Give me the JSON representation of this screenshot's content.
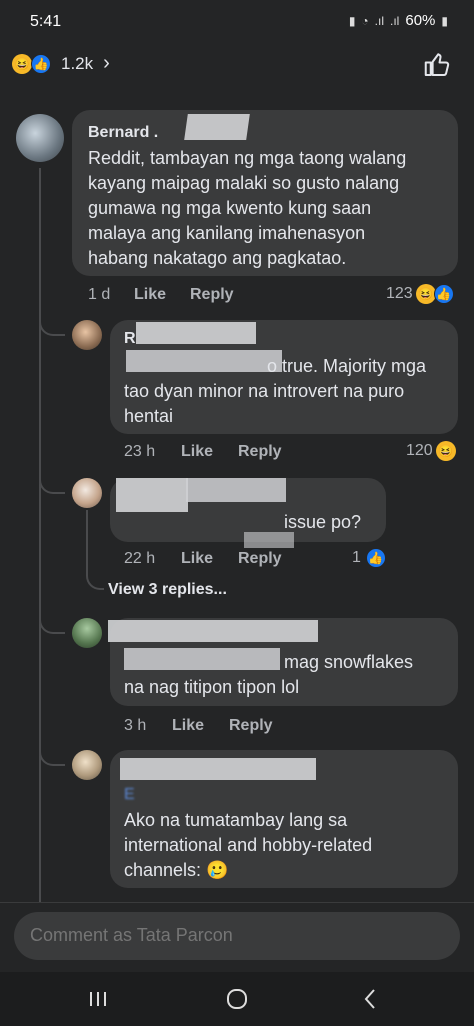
{
  "status": {
    "time": "5:41",
    "battery": "60%"
  },
  "header": {
    "reaction_count": "1.2k"
  },
  "comments": [
    {
      "author": "Bernard .",
      "text_lines": [
        "Reddit, tambayan ng mga taong walang",
        "kayang maipag malaki so gusto nalang",
        "gumawa ng mga kwento kung saan",
        "malaya ang kanilang imahenasyon",
        "habang nakatago ang pagkatao."
      ],
      "time": "1 d",
      "like": "Like",
      "reply": "Reply",
      "reactions": "123"
    },
    {
      "author": "R",
      "text_lines": [
        "o true. Majority mga",
        "tao dyan minor na introvert na puro",
        "hentai"
      ],
      "time": "23 h",
      "like": "Like",
      "reply": "Reply",
      "reactions": "120"
    },
    {
      "text_lines": [
        "issue po?"
      ],
      "time": "22 h",
      "like": "Like",
      "reply": "Reply",
      "reactions": "1"
    },
    {
      "text_lines": [
        "mag snowflakes",
        "na nag titipon tipon lol"
      ],
      "time": "3 h",
      "like": "Like",
      "reply": "Reply"
    },
    {
      "text_lines": [
        "Ako na tumatambay lang sa",
        "international and hobby-related",
        "channels: 🥲"
      ]
    }
  ],
  "view_replies": "View 3 replies...",
  "composer": {
    "placeholder": "Comment as Tata Parcon"
  },
  "colors": {
    "background": "#242526",
    "bubble": "#3a3b3c",
    "like_blue": "#1877f2",
    "haha_yellow": "#f7b928"
  }
}
